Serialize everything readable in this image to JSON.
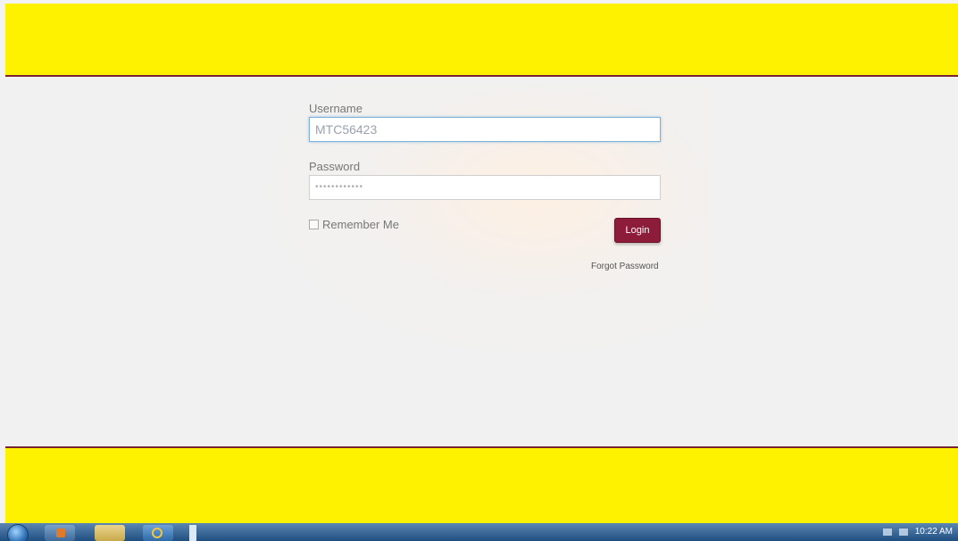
{
  "login": {
    "username_label": "Username",
    "username_value": "MTC56423",
    "password_label": "Password",
    "password_value": "••••••••••••",
    "remember_label": "Remember Me",
    "remember_checked": false,
    "login_button": "Login",
    "forgot_link": "Forgot Password"
  },
  "taskbar": {
    "clock_time": "10:22 AM",
    "items": [
      {
        "icon": "start-orb-icon"
      },
      {
        "icon": "media-player-icon"
      },
      {
        "icon": "folder-icon"
      },
      {
        "icon": "internet-explorer-icon"
      }
    ]
  },
  "colors": {
    "banner": "#fff200",
    "border": "#7a2330",
    "login_button": "#8d1b3a",
    "background": "#f1f1f1"
  }
}
